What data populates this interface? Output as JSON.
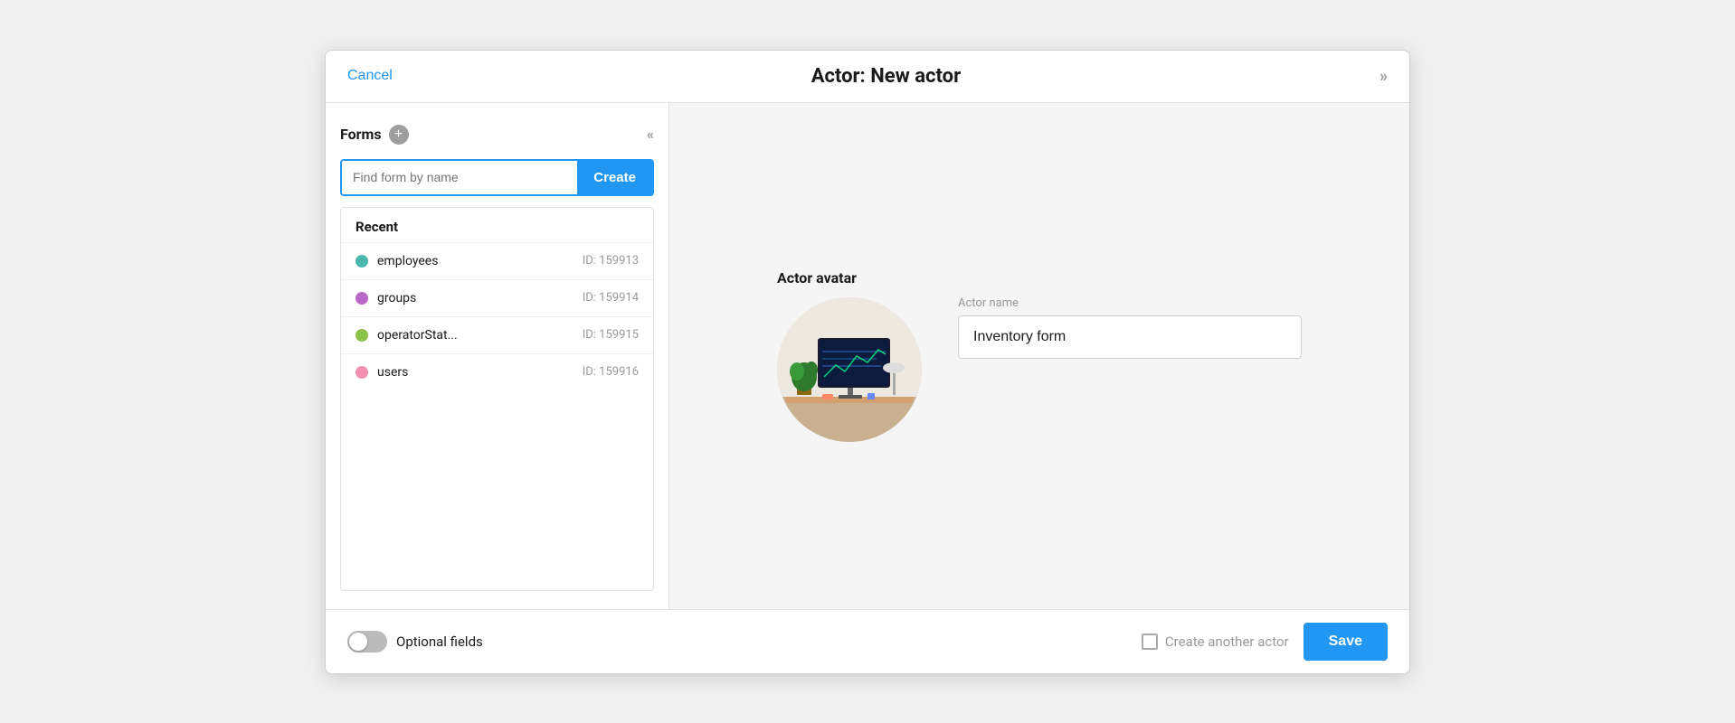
{
  "header": {
    "cancel_label": "Cancel",
    "title": "Actor: New actor",
    "expand_icon": "»"
  },
  "left_panel": {
    "forms_title": "Forms",
    "add_icon": "+",
    "collapse_icon": "«",
    "search_placeholder": "Find form by name",
    "create_button_label": "Create",
    "recent_section_title": "Recent",
    "recent_items": [
      {
        "name": "employees",
        "id": "ID: 159913",
        "dot_class": "dot-teal"
      },
      {
        "name": "groups",
        "id": "ID: 159914",
        "dot_class": "dot-purple"
      },
      {
        "name": "operatorStat...",
        "id": "ID: 159915",
        "dot_class": "dot-green"
      },
      {
        "name": "users",
        "id": "ID: 159916",
        "dot_class": "dot-pink"
      }
    ]
  },
  "right_panel": {
    "avatar_label": "Actor avatar",
    "actor_name_label": "Actor name",
    "actor_name_value": "Inventory form"
  },
  "footer": {
    "optional_fields_label": "Optional fields",
    "create_another_label": "Create another actor",
    "save_button_label": "Save"
  }
}
